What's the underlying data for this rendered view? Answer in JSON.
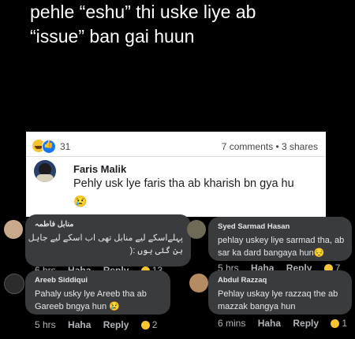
{
  "caption": {
    "line1": "pehle “eshu” thi uske liye ab",
    "line2": "“issue” ban gai huun"
  },
  "post": {
    "reaction_count": "31",
    "stats": "7 comments • 3 shares",
    "commenter": "Faris Malik",
    "comment": "Pehly usk lye faris tha ab kharish bn gya hu",
    "emoji": "😢"
  },
  "comments": [
    {
      "name": "منابل فاطمہ",
      "text_line1": "پہلےاسکے لیے منابل تھی اب اسکے لیے جاہل",
      "text_line2": "بن گئی ہوں :(",
      "time": "6 hrs",
      "haha": "Haha",
      "reply": "Reply",
      "count": "13"
    },
    {
      "name": "Syed Sarmad Hasan",
      "text_line1": "pehlay uskey liye sarmad tha, ab",
      "text_line2": "sar ka dard bangaya hun😔",
      "time": "5 hrs",
      "haha": "Haha",
      "reply": "Reply",
      "count": "7"
    },
    {
      "name": "Areeb Siddiqui",
      "text_line1": "Pahaly usky lye Areeb tha ab",
      "text_line2": "Gareeb bngya hun 😢",
      "time": "5 hrs",
      "haha": "Haha",
      "reply": "Reply",
      "count": "2"
    },
    {
      "name": "Abdul Razzaq",
      "text_line1": "Pehlay uskay lye razzaq the ab",
      "text_line2": "mazzak bangya hun",
      "time": "6 mins",
      "haha": "Haha",
      "reply": "Reply",
      "count": "1"
    }
  ],
  "colors": {
    "bubble": "#3a3b3c",
    "card": "#ffffff",
    "background": "#000000"
  }
}
